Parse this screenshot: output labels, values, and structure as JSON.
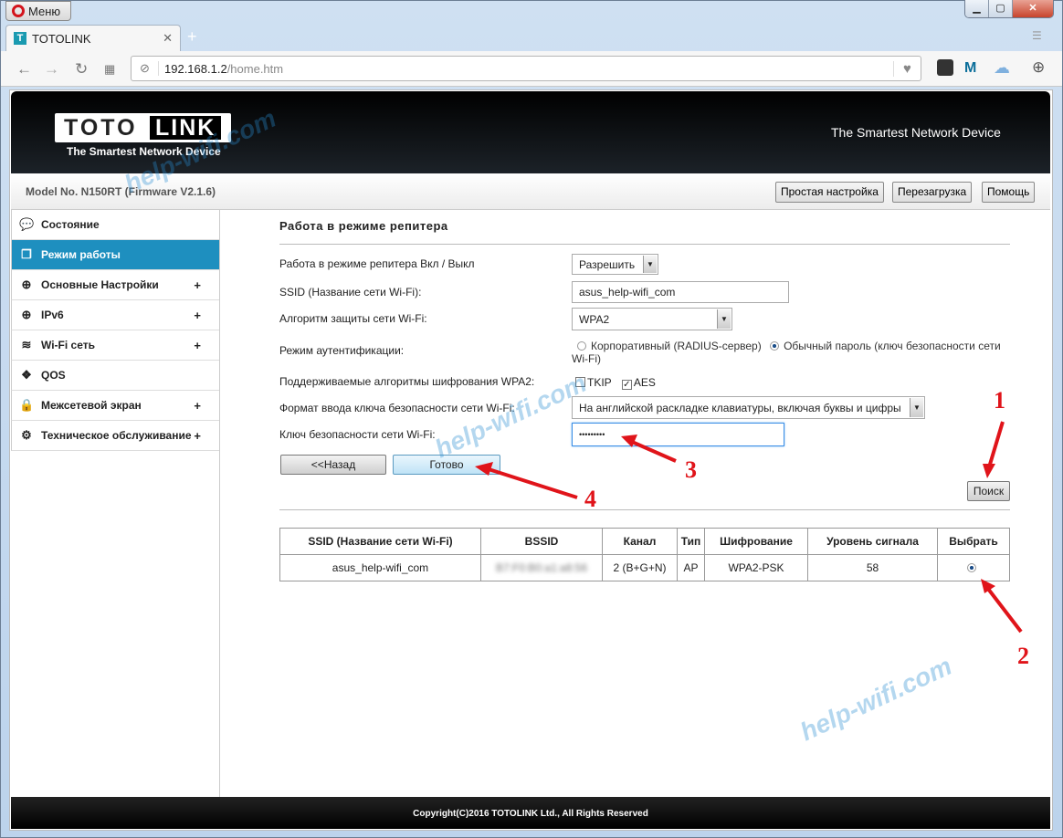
{
  "browser": {
    "menu_label": "Меню",
    "tab_title": "TOTOLINK",
    "tab_favicon": "T",
    "url_host": "192.168.1.2",
    "url_path": "/home.htm"
  },
  "header": {
    "logo_left": "TOTO",
    "logo_right": "LINK",
    "logo_tagline": "The Smartest Network Device",
    "tagline_right": "The Smartest Network Device"
  },
  "modelbar": {
    "model": "Model No. N150RT (Firmware V2.1.6)",
    "buttons": [
      "Простая настройка",
      "Перезагрузка",
      "Помощь"
    ]
  },
  "sidebar": {
    "items": [
      {
        "label": "Состояние",
        "icon": "chat-icon",
        "expandable": false,
        "active": false
      },
      {
        "label": "Режим работы",
        "icon": "windows-icon",
        "expandable": false,
        "active": true
      },
      {
        "label": "Основные Настройки",
        "icon": "globe-icon",
        "expandable": true,
        "active": false
      },
      {
        "label": "IPv6",
        "icon": "globe-icon",
        "expandable": true,
        "active": false
      },
      {
        "label": "Wi-Fi сеть",
        "icon": "wifi-icon",
        "expandable": true,
        "active": false
      },
      {
        "label": "QOS",
        "icon": "diamond-icon",
        "expandable": false,
        "active": false
      },
      {
        "label": "Межсетевой экран",
        "icon": "lock-icon",
        "expandable": true,
        "active": false
      },
      {
        "label": "Техническое обслуживание",
        "icon": "gear-icon",
        "expandable": true,
        "active": false
      }
    ],
    "plus": "+"
  },
  "main": {
    "title": "Работа в режиме репитера",
    "repeater_label": "Работа в режиме репитера Вкл / Выкл",
    "repeater_value": "Разрешить",
    "ssid_label": "SSID (Название сети Wi-Fi):",
    "ssid_value": "asus_help-wifi_com",
    "security_label": "Алгоритм защиты сети Wi-Fi:",
    "security_value": "WPA2",
    "auth_label": "Режим аутентификации:",
    "auth_enterprise": "Корпоративный (RADIUS-сервер)",
    "auth_personal": "Обычный пароль (ключ безопасности сети Wi-Fi)",
    "auth_selected": "personal",
    "cipher_label": "Поддерживаемые алгоритмы шифрования WPA2:",
    "tkip": "TKIP",
    "tkip_checked": false,
    "aes": "AES",
    "aes_checked": true,
    "keyformat_label": "Формат ввода ключа безопасности сети Wi-Fi:",
    "keyformat_value": "На английской раскладке клавиатуры, включая буквы и цифры",
    "key_label": "Ключ безопасности сети Wi-Fi:",
    "key_value": "•••••••••",
    "back_button": "<<Назад",
    "done_button": "Готово",
    "search_button": "Поиск"
  },
  "scan_table": {
    "headers": [
      "SSID (Название сети Wi-Fi)",
      "BSSID",
      "Канал",
      "Тип",
      "Шифрование",
      "Уровень сигнала",
      "Выбрать"
    ],
    "rows": [
      {
        "ssid": "asus_help-wifi_com",
        "bssid": "B7:F0:B0:a1:a8:56",
        "channel": "2 (B+G+N)",
        "type": "AP",
        "encryption": "WPA2-PSK",
        "signal": "58",
        "selected": true
      }
    ]
  },
  "footer": {
    "copyright": "Copyright(C)2016 TOTOLINK Ltd., All Rights Reserved"
  },
  "watermark": "help-wifi.com",
  "annotations": {
    "color": "#e0141a",
    "labels": [
      "1",
      "2",
      "3",
      "4"
    ]
  }
}
